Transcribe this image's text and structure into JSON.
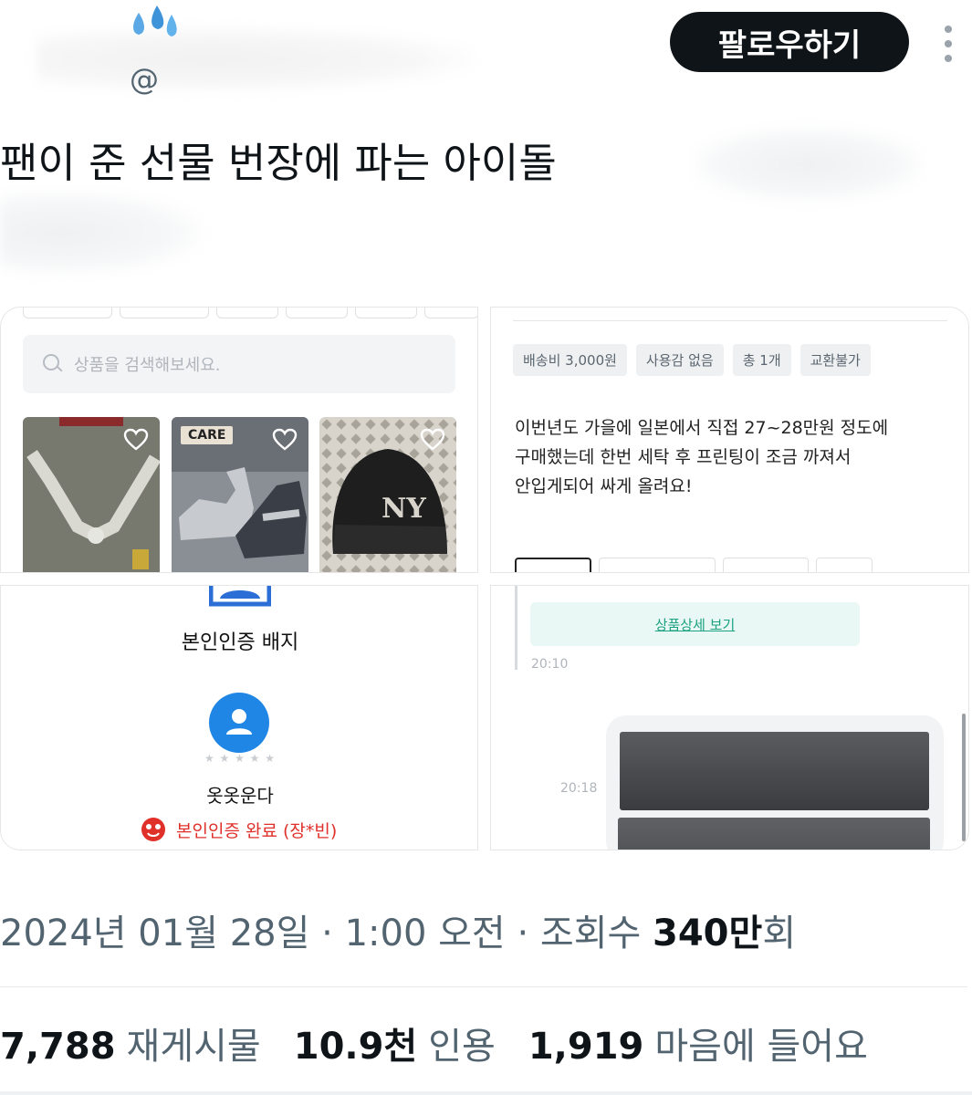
{
  "header": {
    "handle_prefix": "@",
    "follow_label": "팔로우하기"
  },
  "tweet": {
    "text": "팬이 준 선물 번장에 파는 아이돌"
  },
  "media": {
    "shop": {
      "search_placeholder": "상품을 검색해보세요.",
      "care_badge": "CARE"
    },
    "listing": {
      "tags": [
        "배송비 3,000원",
        "사용감 없음",
        "총 1개",
        "교환불가"
      ],
      "description": [
        "이번년도 가을에 일본에서 직접 27~28만원 정도에",
        "구매했는데 한번 세탁 후 프린팅이 조금 까져서",
        "안입게되어 싸게 올려요!"
      ]
    },
    "profile": {
      "badge_label": "본인인증 배지",
      "nickname": "옷옷운다",
      "verified_text": "본인인증 완료 (장*빈)"
    },
    "chat": {
      "detail_link": "상품상세 보기",
      "time_1": "20:10",
      "time_2": "20:18"
    }
  },
  "meta": {
    "date": "2024년 01월 28일",
    "time": "1:00 오전",
    "views_label": "조회수",
    "views_value": "340만",
    "views_suffix": "회",
    "separator": " · "
  },
  "stats": {
    "retweets_value": "7,788",
    "retweets_label": "재게시물",
    "quotes_value": "10.9천",
    "quotes_label": "인용",
    "likes_value": "1,919",
    "likes_label": "마음에 들어요"
  },
  "colors": {
    "follow_bg": "#0f1419",
    "secondary_text": "#536471",
    "verified_red": "#e0302a",
    "avatar_blue": "#1f86e6",
    "link_green": "#1aa181"
  }
}
